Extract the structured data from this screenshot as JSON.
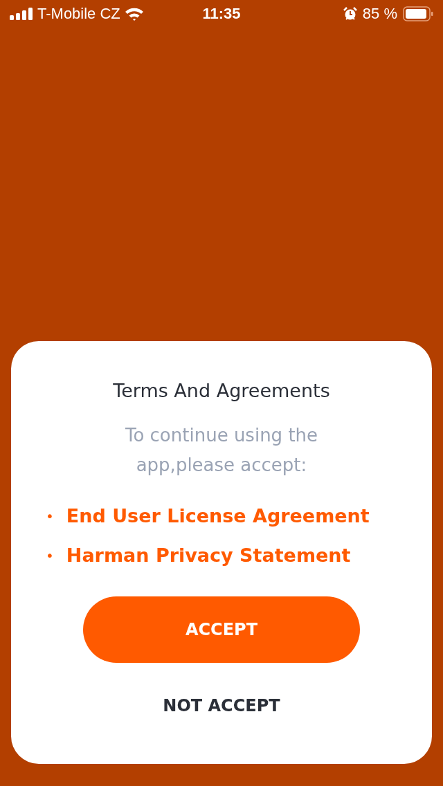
{
  "status_bar": {
    "carrier": "T-Mobile CZ",
    "time": "11:35",
    "battery": "85 %"
  },
  "dialog": {
    "title": "Terms And Agreements",
    "message": "To continue using the app,please accept:",
    "links": [
      {
        "bullet": "•",
        "label": "End User License Agreement"
      },
      {
        "bullet": "•",
        "label": "Harman Privacy Statement"
      }
    ],
    "buttons": [
      {
        "kind": "primary",
        "label": "ACCEPT"
      },
      {
        "kind": "text",
        "label": "NOT ACCEPT"
      }
    ]
  }
}
